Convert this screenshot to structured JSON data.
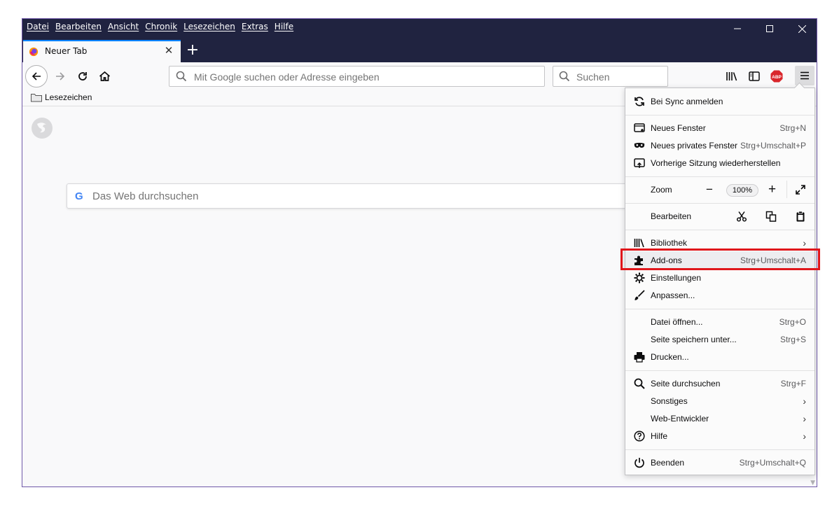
{
  "menubar": [
    "Datei",
    "Bearbeiten",
    "Ansicht",
    "Chronik",
    "Lesezeichen",
    "Extras",
    "Hilfe"
  ],
  "tab": {
    "title": "Neuer Tab",
    "close": "✕"
  },
  "newtab": "+",
  "urlbar": {
    "placeholder": "Mit Google suchen oder Adresse eingeben"
  },
  "searchbar": {
    "placeholder": "Suchen"
  },
  "bookmarks": {
    "folder_label": "Lesezeichen"
  },
  "websearch": {
    "placeholder": "Das Web durchsuchen",
    "logo": "G"
  },
  "panel": {
    "sync": "Bei Sync anmelden",
    "new_window": {
      "label": "Neues Fenster",
      "shortcut": "Strg+N"
    },
    "private_window": {
      "label": "Neues privates Fenster",
      "shortcut": "Strg+Umschalt+P"
    },
    "restore": "Vorherige Sitzung wiederherstellen",
    "zoom": {
      "label": "Zoom",
      "minus": "−",
      "value": "100%",
      "plus": "+"
    },
    "edit": {
      "label": "Bearbeiten"
    },
    "library": "Bibliothek",
    "addons": {
      "label": "Add-ons",
      "shortcut": "Strg+Umschalt+A"
    },
    "settings": "Einstellungen",
    "customize": "Anpassen...",
    "open_file": {
      "label": "Datei öffnen...",
      "shortcut": "Strg+O"
    },
    "save_page": {
      "label": "Seite speichern unter...",
      "shortcut": "Strg+S"
    },
    "print": "Drucken...",
    "find": {
      "label": "Seite durchsuchen",
      "shortcut": "Strg+F"
    },
    "more": "Sonstiges",
    "webdev": "Web-Entwickler",
    "help": "Hilfe",
    "quit": {
      "label": "Beenden",
      "shortcut": "Strg+Umschalt+Q"
    },
    "chevron": "›"
  },
  "colors": {
    "titlebar": "#202340",
    "accent_tab": "#0a84ff",
    "highlight_box": "#e0161b",
    "abp_red": "#d9262c"
  }
}
